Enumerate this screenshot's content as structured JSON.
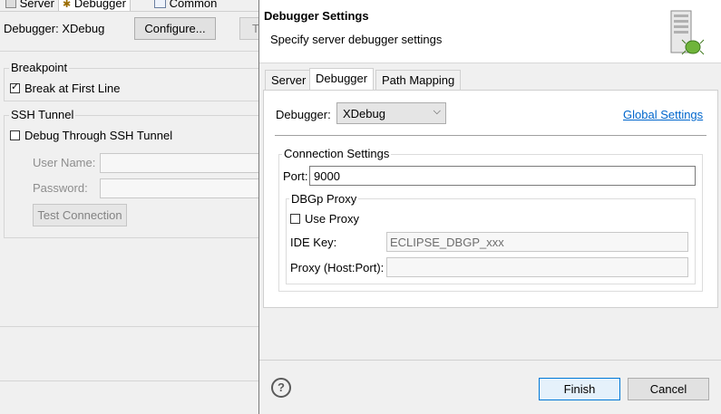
{
  "background_window": {
    "tabs": [
      {
        "label": "Server",
        "icon": "server-icon"
      },
      {
        "label": "Debugger",
        "icon": "bug-icon"
      },
      {
        "label": "Common",
        "icon": "common-icon"
      }
    ],
    "debugger_label": "Debugger: XDebug",
    "configure_button": "Configure...",
    "truncated_button": "T",
    "breakpoint_group": "Breakpoint",
    "break_at_first_line": "Break at First Line",
    "break_at_first_line_checked": true,
    "ssh_group": "SSH Tunnel",
    "debug_through_ssh": "Debug Through SSH Tunnel",
    "debug_through_ssh_checked": false,
    "user_name_label": "User Name:",
    "password_label": "Password:",
    "test_connection": "Test Connection"
  },
  "dialog": {
    "title": "Debugger Settings",
    "subtitle": "Specify server debugger settings",
    "header_icon": "server-bug-icon",
    "tabs": [
      "Server",
      "Debugger",
      "Path Mapping"
    ],
    "selected_tab": "Debugger",
    "debugger_label": "Debugger:",
    "debugger_value": "XDebug",
    "global_settings_link": "Global Settings",
    "connection_group": "Connection Settings",
    "port_label": "Port:",
    "port_value": "9000",
    "proxy_group": "DBGp Proxy",
    "use_proxy_label": "Use Proxy",
    "use_proxy_checked": false,
    "ide_key_label": "IDE Key:",
    "ide_key_value": "ECLIPSE_DBGP_xxx",
    "proxy_host_label": "Proxy (Host:Port):",
    "proxy_host_value": "",
    "help_icon": "help-icon",
    "finish_button": "Finish",
    "cancel_button": "Cancel",
    "link_color": "#0066cc"
  }
}
